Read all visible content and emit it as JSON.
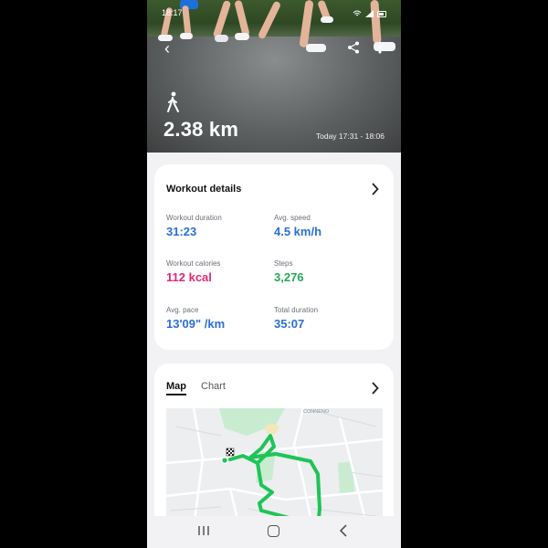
{
  "status_bar": {
    "time": "18:17",
    "battery": ""
  },
  "hero": {
    "activity_icon": "walking-person-icon",
    "distance": "2.38 km",
    "timespan": "Today 17:31 - 18:06"
  },
  "workout_details": {
    "title": "Workout details",
    "stats": [
      {
        "label": "Workout duration",
        "value": "31:23",
        "color": "#2a6fd6"
      },
      {
        "label": "Avg. speed",
        "value": "4.5 km/h",
        "color": "#2a6fd6"
      },
      {
        "label": "Workout calories",
        "value": "112 kcal",
        "color": "#e0287a"
      },
      {
        "label": "Steps",
        "value": "3,276",
        "color": "#26a85a"
      },
      {
        "label": "Avg. pace",
        "value": "13'09\" /km",
        "color": "#2a6fd6"
      },
      {
        "label": "Total duration",
        "value": "35:07",
        "color": "#2a6fd6"
      }
    ]
  },
  "map_section": {
    "tabs": [
      {
        "label": "Map",
        "active": true
      },
      {
        "label": "Chart",
        "active": false
      }
    ],
    "map_label": "CONNENO",
    "route_color": "#1fc456"
  },
  "navbar": {
    "recent": "recent-apps-icon",
    "home": "home-icon",
    "back": "back-icon"
  }
}
